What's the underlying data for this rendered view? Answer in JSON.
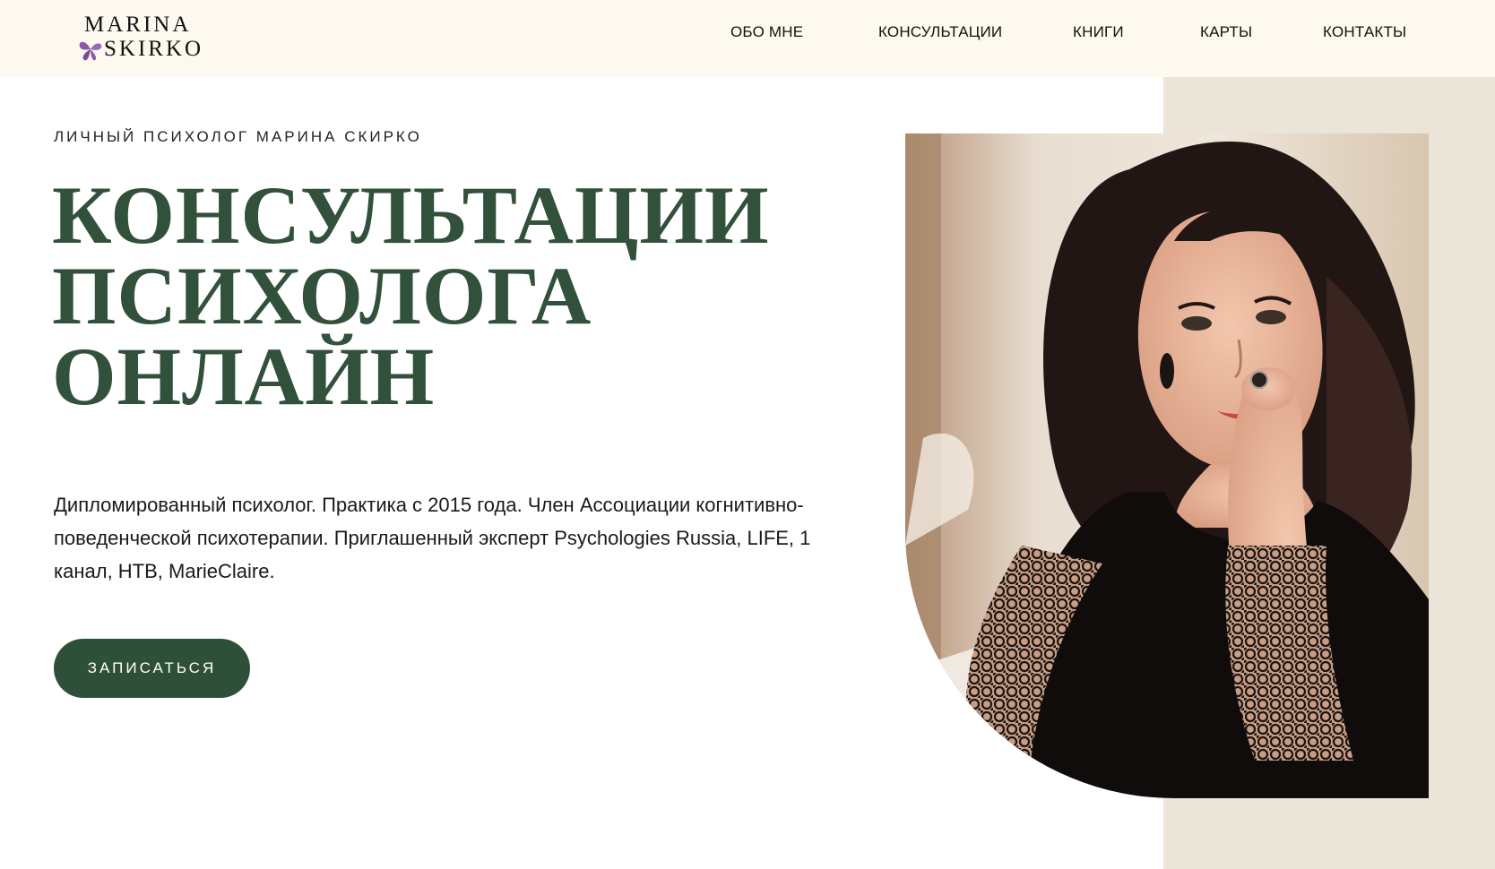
{
  "logo": {
    "line1": "MARINA",
    "line2": "SKIRKO",
    "icon": "butterfly-icon",
    "icon_color": "#8a5aa8"
  },
  "nav": {
    "items": [
      {
        "label": "ОБО МНЕ"
      },
      {
        "label": "КОНСУЛЬТАЦИИ"
      },
      {
        "label": "КНИГИ"
      },
      {
        "label": "КАРТЫ"
      },
      {
        "label": "КОНТАКТЫ"
      }
    ]
  },
  "hero": {
    "kicker": "ЛИЧНЫЙ ПСИХОЛОГ МАРИНА СКИРКО",
    "headline": [
      "КОНСУЛЬТАЦИИ",
      "ПСИХОЛОГА",
      "ОНЛАЙН"
    ],
    "description": "Дипломированный психолог. Практика с 2015 года. Член Ассоциации когнитивно-поведенческой психотерапии. Приглашенный эксперт Psychologies Russia, LIFE, 1 канал, НТВ, MarieClaire.",
    "cta_label": "ЗАПИСАТЬСЯ"
  },
  "colors": {
    "header_bg": "#fdf9ee",
    "accent_green": "#2f5038",
    "headline_green": "#31513a",
    "panel_beige": "#ebe4d9"
  }
}
